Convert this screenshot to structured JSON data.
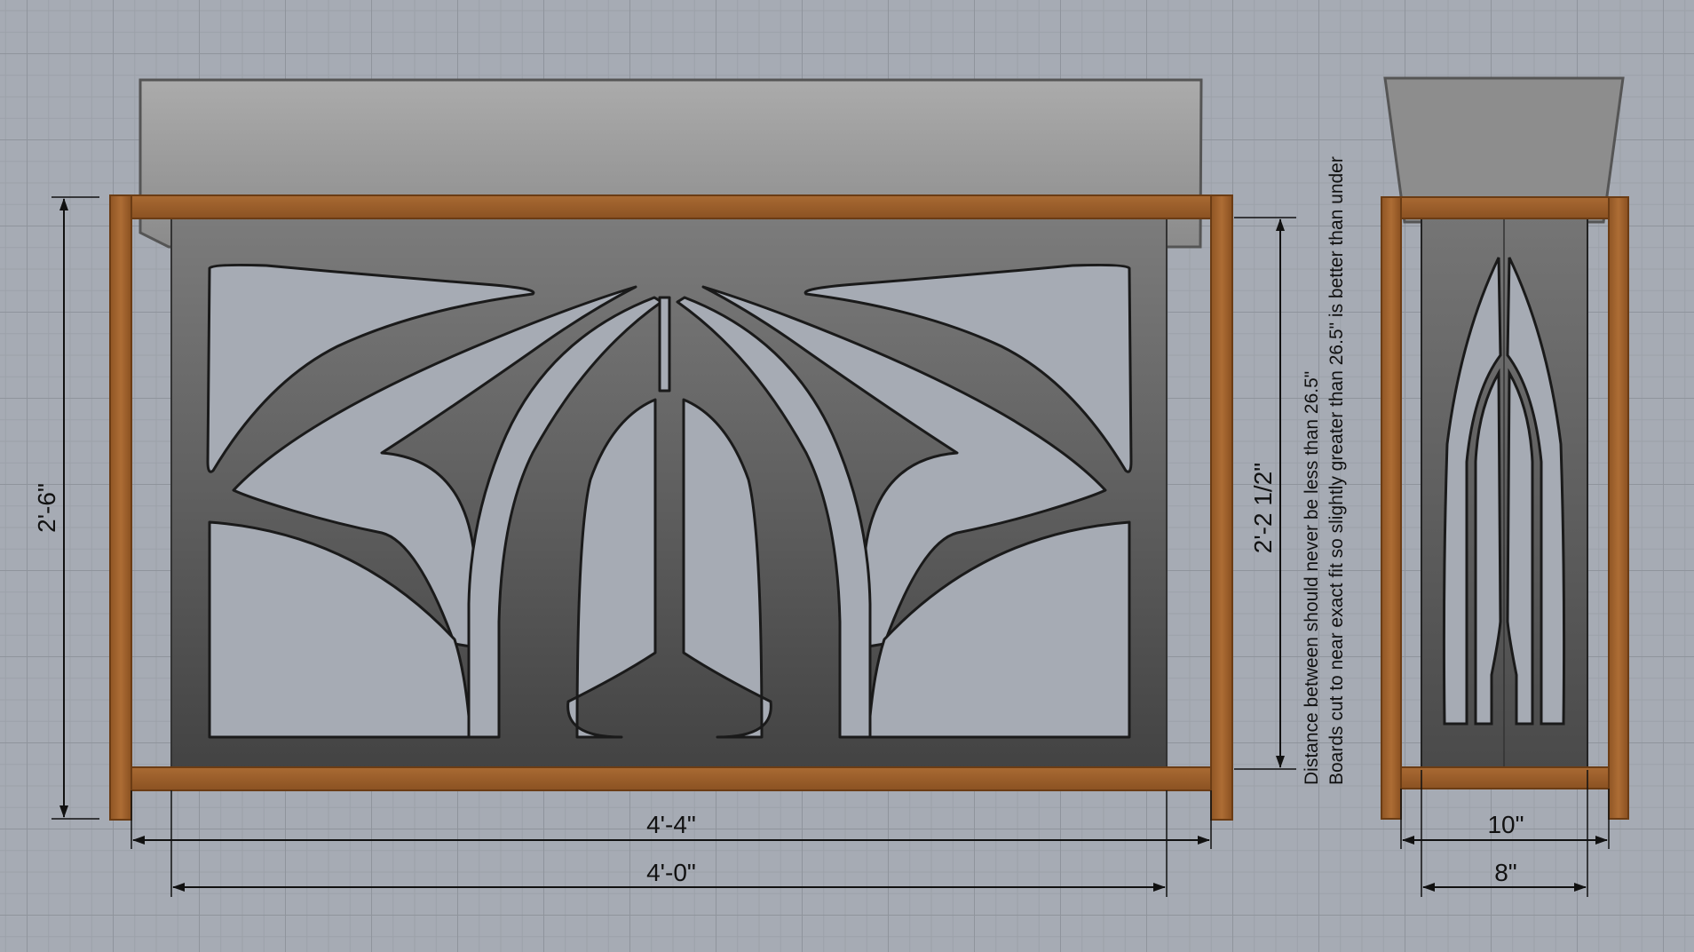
{
  "dimensions": {
    "overall_height": "2'-6\"",
    "front_outer_width": "4'-4\"",
    "front_inner_width": "4'-0\"",
    "panel_height": "2'-2 1/2\"",
    "side_outer_width": "10\"",
    "side_inner_width": "8\""
  },
  "notes": {
    "line1": "Distance between should never be less than 26.5\"",
    "line2": "Boards cut to near exact fit so slightly greater than 26.5\" is better than under"
  },
  "colors": {
    "wood": "#a0622c",
    "wood_edge": "#6b3c14",
    "panel_top": "#7b7b7b",
    "panel_bottom": "#454545",
    "planter_top": "#a9a9a9",
    "planter_bottom": "#8a8a8a",
    "cutout": "#a6abb4"
  }
}
